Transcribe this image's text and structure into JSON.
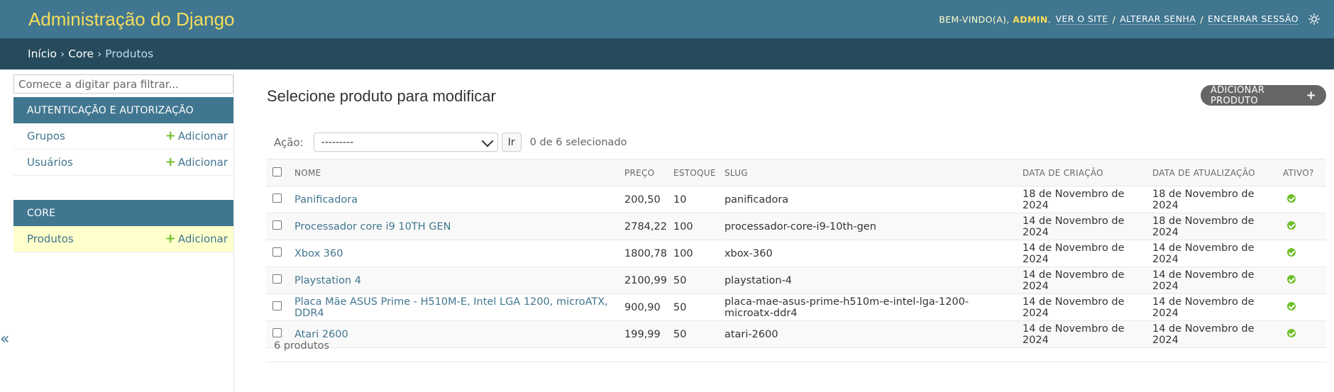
{
  "header": {
    "brand": "Administração do Django",
    "welcome": "Bem-vindo(a),",
    "username": "admin",
    "links": [
      "Ver o site",
      "Alterar senha",
      "Encerrar sessão"
    ]
  },
  "breadcrumbs": [
    "Início",
    "Core",
    "Produtos"
  ],
  "sidebar": {
    "filter_placeholder": "Comece a digitar para filtrar...",
    "apps": [
      {
        "caption": "Autenticação e Autorização",
        "models": [
          {
            "label": "Grupos",
            "add": "Adicionar"
          },
          {
            "label": "Usuários",
            "add": "Adicionar"
          }
        ]
      },
      {
        "caption": "Core",
        "models": [
          {
            "label": "Produtos",
            "add": "Adicionar",
            "current": true
          }
        ]
      }
    ],
    "collapse": "«"
  },
  "main": {
    "title": "Selecione produto para modificar",
    "add_button": "Adicionar produto",
    "action_label": "Ação:",
    "action_value": "---------",
    "go_label": "Ir",
    "selection_count": "0 de 6 selecionado",
    "columns": [
      "Nome",
      "Preço",
      "Estoque",
      "Slug",
      "Data de criação",
      "Data de atualização",
      "Ativo?"
    ],
    "rows": [
      {
        "nome": "Panificadora",
        "preco": "200,50",
        "estoque": "10",
        "slug": "panificadora",
        "criacao": "18 de Novembro de 2024",
        "atualizacao": "18 de Novembro de 2024",
        "ativo": true
      },
      {
        "nome": "Processador core i9 10TH GEN",
        "preco": "2784,22",
        "estoque": "100",
        "slug": "processador-core-i9-10th-gen",
        "criacao": "14 de Novembro de 2024",
        "atualizacao": "18 de Novembro de 2024",
        "ativo": true
      },
      {
        "nome": "Xbox 360",
        "preco": "1800,78",
        "estoque": "100",
        "slug": "xbox-360",
        "criacao": "14 de Novembro de 2024",
        "atualizacao": "14 de Novembro de 2024",
        "ativo": true
      },
      {
        "nome": "Playstation 4",
        "preco": "2100,99",
        "estoque": "50",
        "slug": "playstation-4",
        "criacao": "14 de Novembro de 2024",
        "atualizacao": "14 de Novembro de 2024",
        "ativo": true
      },
      {
        "nome": "Placa Mãe ASUS Prime - H510M-E, Intel LGA 1200, microATX, DDR4",
        "preco": "900,90",
        "estoque": "50",
        "slug": "placa-mae-asus-prime-h510m-e-intel-lga-1200-microatx-ddr4",
        "criacao": "14 de Novembro de 2024",
        "atualizacao": "14 de Novembro de 2024",
        "ativo": true
      },
      {
        "nome": "Atari 2600",
        "preco": "199,99",
        "estoque": "50",
        "slug": "atari-2600",
        "criacao": "14 de Novembro de 2024",
        "atualizacao": "14 de Novembro de 2024",
        "ativo": true
      }
    ],
    "paginator": "6 produtos"
  },
  "colors": {
    "header_bg": "#417690",
    "breadcrumbs_bg": "#264b5d",
    "brand": "#f5dd5d",
    "link": "#417690",
    "add_green": "#70bf2b",
    "current_row": "#ffffcc"
  },
  "icons": {
    "theme_toggle": "sun-icon",
    "add": "plus-icon",
    "active": "check-circle-icon"
  }
}
